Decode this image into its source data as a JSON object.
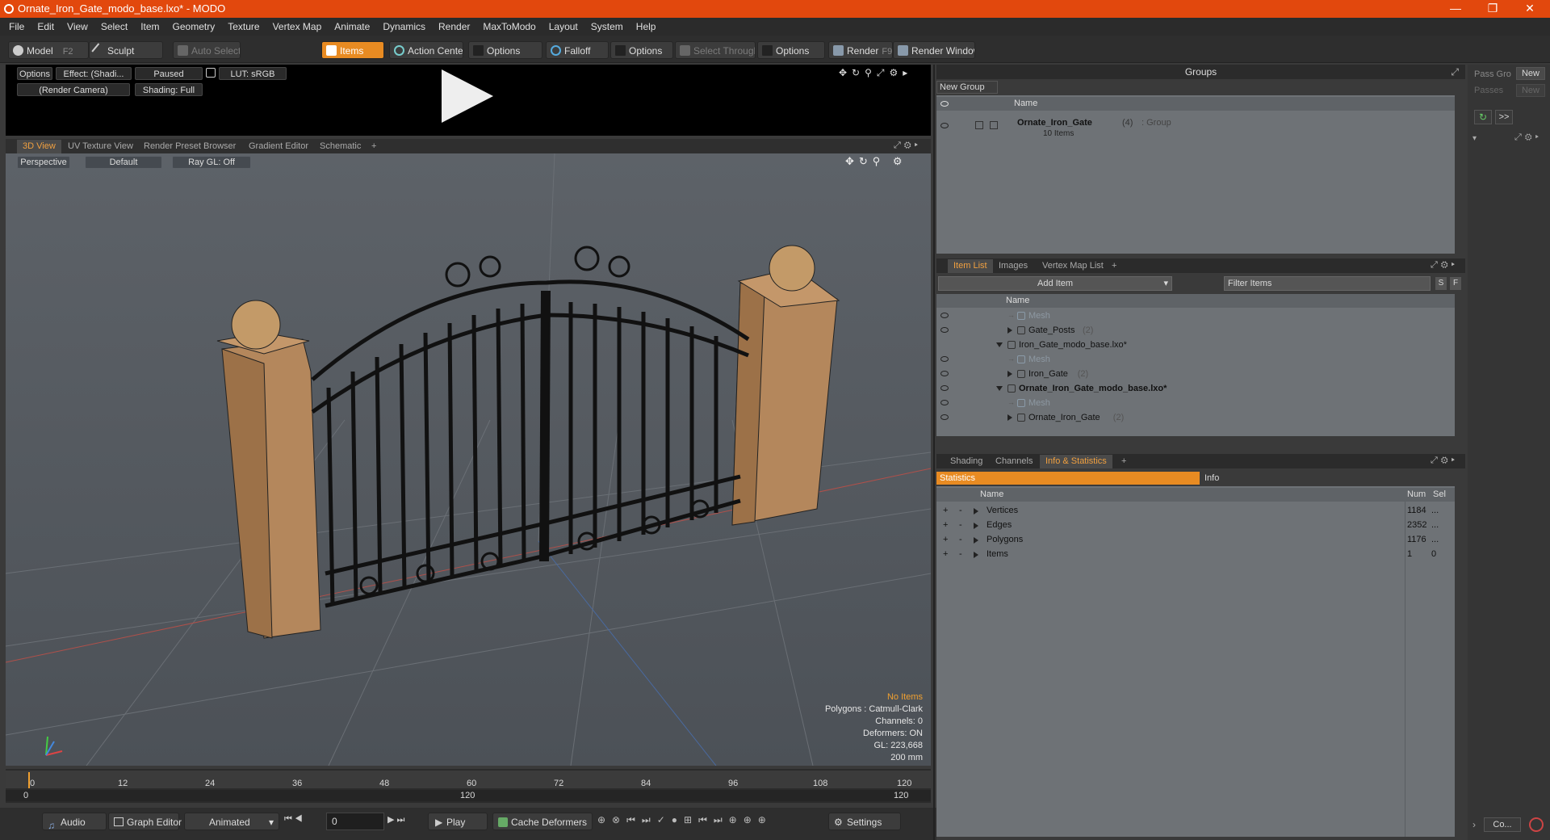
{
  "window": {
    "title": "Ornate_Iron_Gate_modo_base.lxo* - MODO",
    "minimize": "—",
    "restore": "❐",
    "close": "✕"
  },
  "menu": [
    "File",
    "Edit",
    "View",
    "Select",
    "Item",
    "Geometry",
    "Texture",
    "Vertex Map",
    "Animate",
    "Dynamics",
    "Render",
    "MaxToModo",
    "Layout",
    "System",
    "Help"
  ],
  "toolbar": {
    "model": "Model",
    "model_shortcut": "F2",
    "sculpt": "Sculpt",
    "auto_select": "Auto Select",
    "items": "Items",
    "action_center": "Action Center",
    "options1": "Options",
    "falloff": "Falloff",
    "options2": "Options",
    "select_through": "Select Through",
    "options3": "Options",
    "render": "Render",
    "render_shortcut": "F9",
    "render_window": "Render Window"
  },
  "preview": {
    "options": "Options",
    "effect": "Effect: (Shadi...",
    "paused": "Paused",
    "lut": "LUT: sRGB",
    "camera": "(Render Camera)",
    "shading": "Shading: Full"
  },
  "view_tabs": [
    "3D View",
    "UV Texture View",
    "Render Preset Browser",
    "Gradient Editor",
    "Schematic",
    "+"
  ],
  "viewport": {
    "projection": "Perspective",
    "style": "Default",
    "raygl": "Ray GL: Off"
  },
  "hud": {
    "no_items": "No Items",
    "polygons": "Polygons : Catmull-Clark",
    "channels": "Channels: 0",
    "deformers": "Deformers: ON",
    "gl": "GL: 223,668",
    "size": "200 mm"
  },
  "timeline": {
    "ticks": [
      "0",
      "12",
      "24",
      "36",
      "48",
      "60",
      "72",
      "84",
      "96",
      "108",
      "120"
    ],
    "sub_left": "0",
    "sub_mid": "120",
    "sub_right": "120"
  },
  "bottombar": {
    "audio": "Audio",
    "graph_editor": "Graph Editor",
    "animated": "Animated",
    "frame": "0",
    "play": "Play",
    "cache_deformers": "Cache Deformers",
    "settings": "Settings"
  },
  "groups": {
    "title": "Groups",
    "new_group": "New Group",
    "col_name": "Name",
    "item_name": "Ornate_Iron_Gate",
    "item_count": "(4)",
    "item_type": ": Group",
    "item_sub": "10 Items"
  },
  "pass": {
    "pass_label": "Pass Gro",
    "passes_label": "Passes",
    "new1": "New",
    "new2": "New",
    "arrows": ">>"
  },
  "item_list": {
    "tabs": [
      "Item List",
      "Images",
      "Vertex Map List",
      "+"
    ],
    "add_item": "Add Item",
    "filter": "Filter Items",
    "s": "S",
    "f": "F",
    "col_name": "Name",
    "rows": [
      {
        "label": "Mesh",
        "indent": 2,
        "dim": true,
        "bold": false,
        "eye": true
      },
      {
        "label": "Gate_Posts",
        "count": "(2)",
        "indent": 2,
        "dim": false,
        "bold": false,
        "eye": true
      },
      {
        "label": "Iron_Gate_modo_base.lxo*",
        "indent": 1,
        "dim": false,
        "bold": false,
        "eye": false
      },
      {
        "label": "Mesh",
        "indent": 2,
        "dim": true,
        "bold": false,
        "eye": true
      },
      {
        "label": "Iron_Gate",
        "count": "(2)",
        "indent": 2,
        "dim": false,
        "bold": false,
        "eye": true
      },
      {
        "label": "Ornate_Iron_Gate_modo_base.lxo*",
        "indent": 1,
        "dim": false,
        "bold": true,
        "eye": true
      },
      {
        "label": "Mesh",
        "indent": 2,
        "dim": true,
        "bold": false,
        "eye": true
      },
      {
        "label": "Ornate_Iron_Gate",
        "count": "(2)",
        "indent": 2,
        "dim": false,
        "bold": false,
        "eye": true
      }
    ]
  },
  "info": {
    "tabs": [
      "Shading",
      "Channels",
      "Info & Statistics",
      "+"
    ],
    "statistics": "Statistics",
    "info": "Info",
    "col_name": "Name",
    "col_num": "Num",
    "col_sel": "Sel",
    "rows": [
      {
        "name": "Vertices",
        "num": "1184",
        "sel": "..."
      },
      {
        "name": "Edges",
        "num": "2352",
        "sel": "..."
      },
      {
        "name": "Polygons",
        "num": "1176",
        "sel": "..."
      },
      {
        "name": "Items",
        "num": "1",
        "sel": "0"
      }
    ]
  },
  "right_bottom": {
    "co": "Co..."
  }
}
